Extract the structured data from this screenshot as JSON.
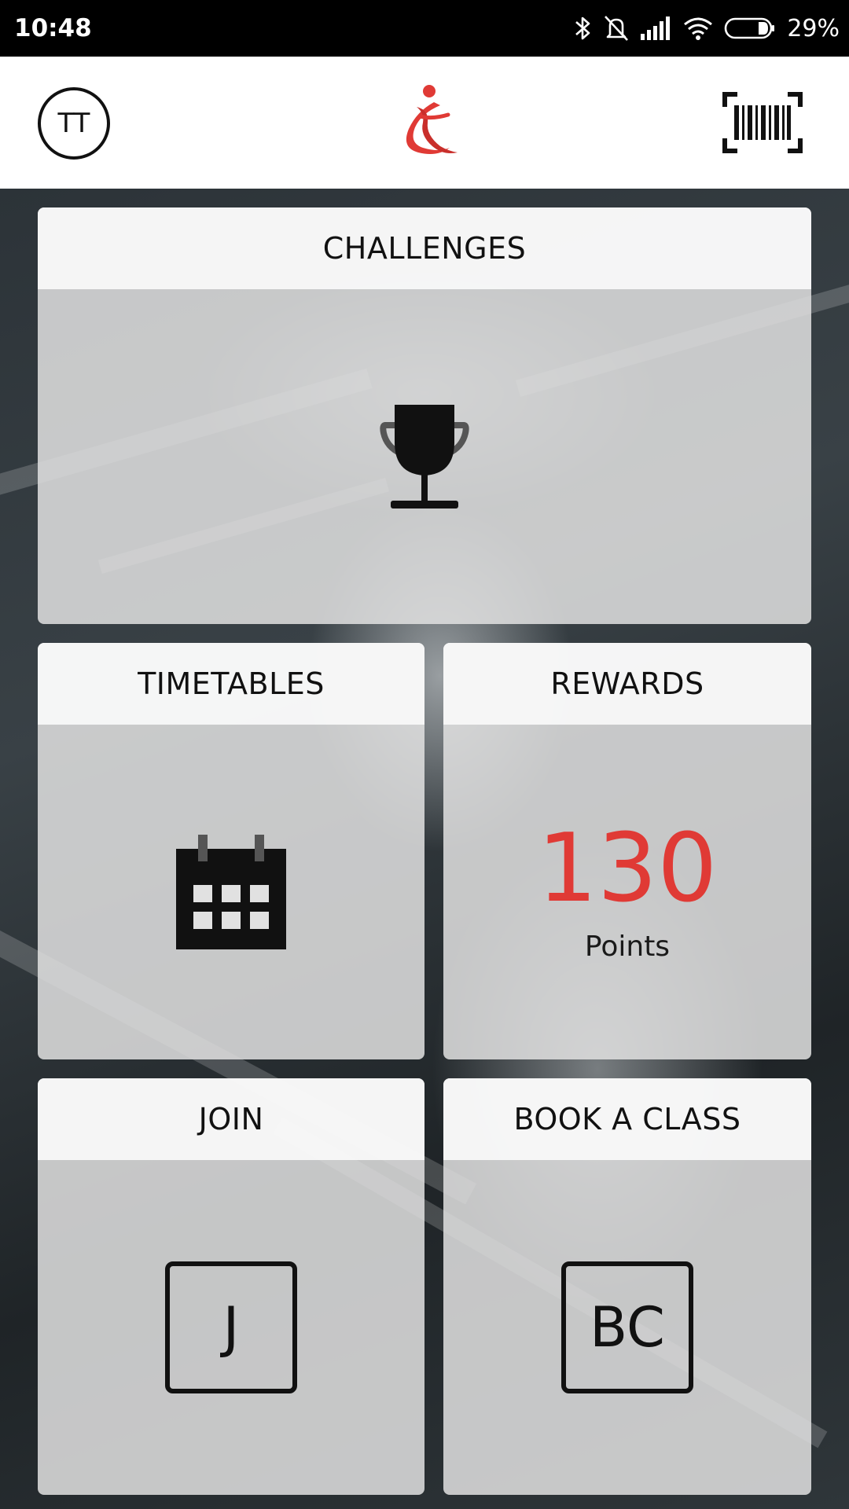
{
  "status_bar": {
    "time": "10:48",
    "battery_percent": "29%",
    "icons": [
      "bluetooth-icon",
      "mute-icon",
      "signal-icon",
      "wifi-icon",
      "battery-icon"
    ]
  },
  "header": {
    "avatar_initials": "TT",
    "logo": "brand-logo",
    "barcode_icon": "barcode-icon"
  },
  "tiles": {
    "challenges": {
      "title": "CHALLENGES",
      "icon": "trophy-icon"
    },
    "timetables": {
      "title": "TIMETABLES",
      "icon": "calendar-icon"
    },
    "rewards": {
      "title": "REWARDS",
      "points": "130",
      "points_label": "Points"
    },
    "join": {
      "title": "JOIN",
      "icon_text": "J"
    },
    "book_a_class": {
      "title": "BOOK A CLASS",
      "icon_text": "BC"
    }
  },
  "colors": {
    "brand_red": "#e03a35",
    "status_bar_bg": "#000000",
    "header_bg": "#ffffff",
    "tile_header_bg": "#f8f8f8",
    "tile_body_bg": "#e1e1e1"
  }
}
